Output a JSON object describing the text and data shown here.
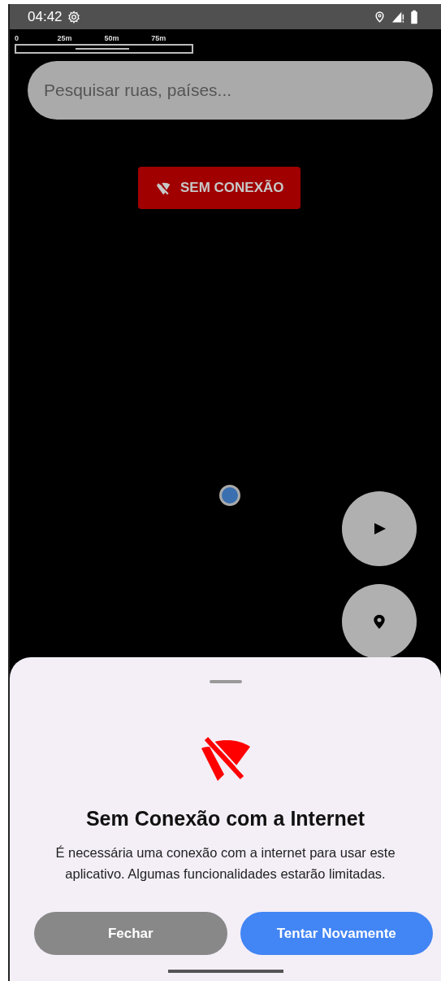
{
  "status_bar": {
    "time": "04:42"
  },
  "scale_bar": {
    "ticks": [
      "0",
      "25m",
      "50m",
      "75m"
    ]
  },
  "search": {
    "placeholder": "Pesquisar ruas, países..."
  },
  "offline_badge": {
    "label": "SEM CONEXÃO"
  },
  "sheet": {
    "title": "Sem Conexão com a Internet",
    "message": "É necessária uma conexão com a internet para usar este aplicativo. Algumas funcionalidades estarão limitadas.",
    "buttons": [
      {
        "label": "Fechar",
        "kind": "secondary"
      },
      {
        "label": "Tentar Novamente",
        "kind": "primary"
      }
    ]
  }
}
